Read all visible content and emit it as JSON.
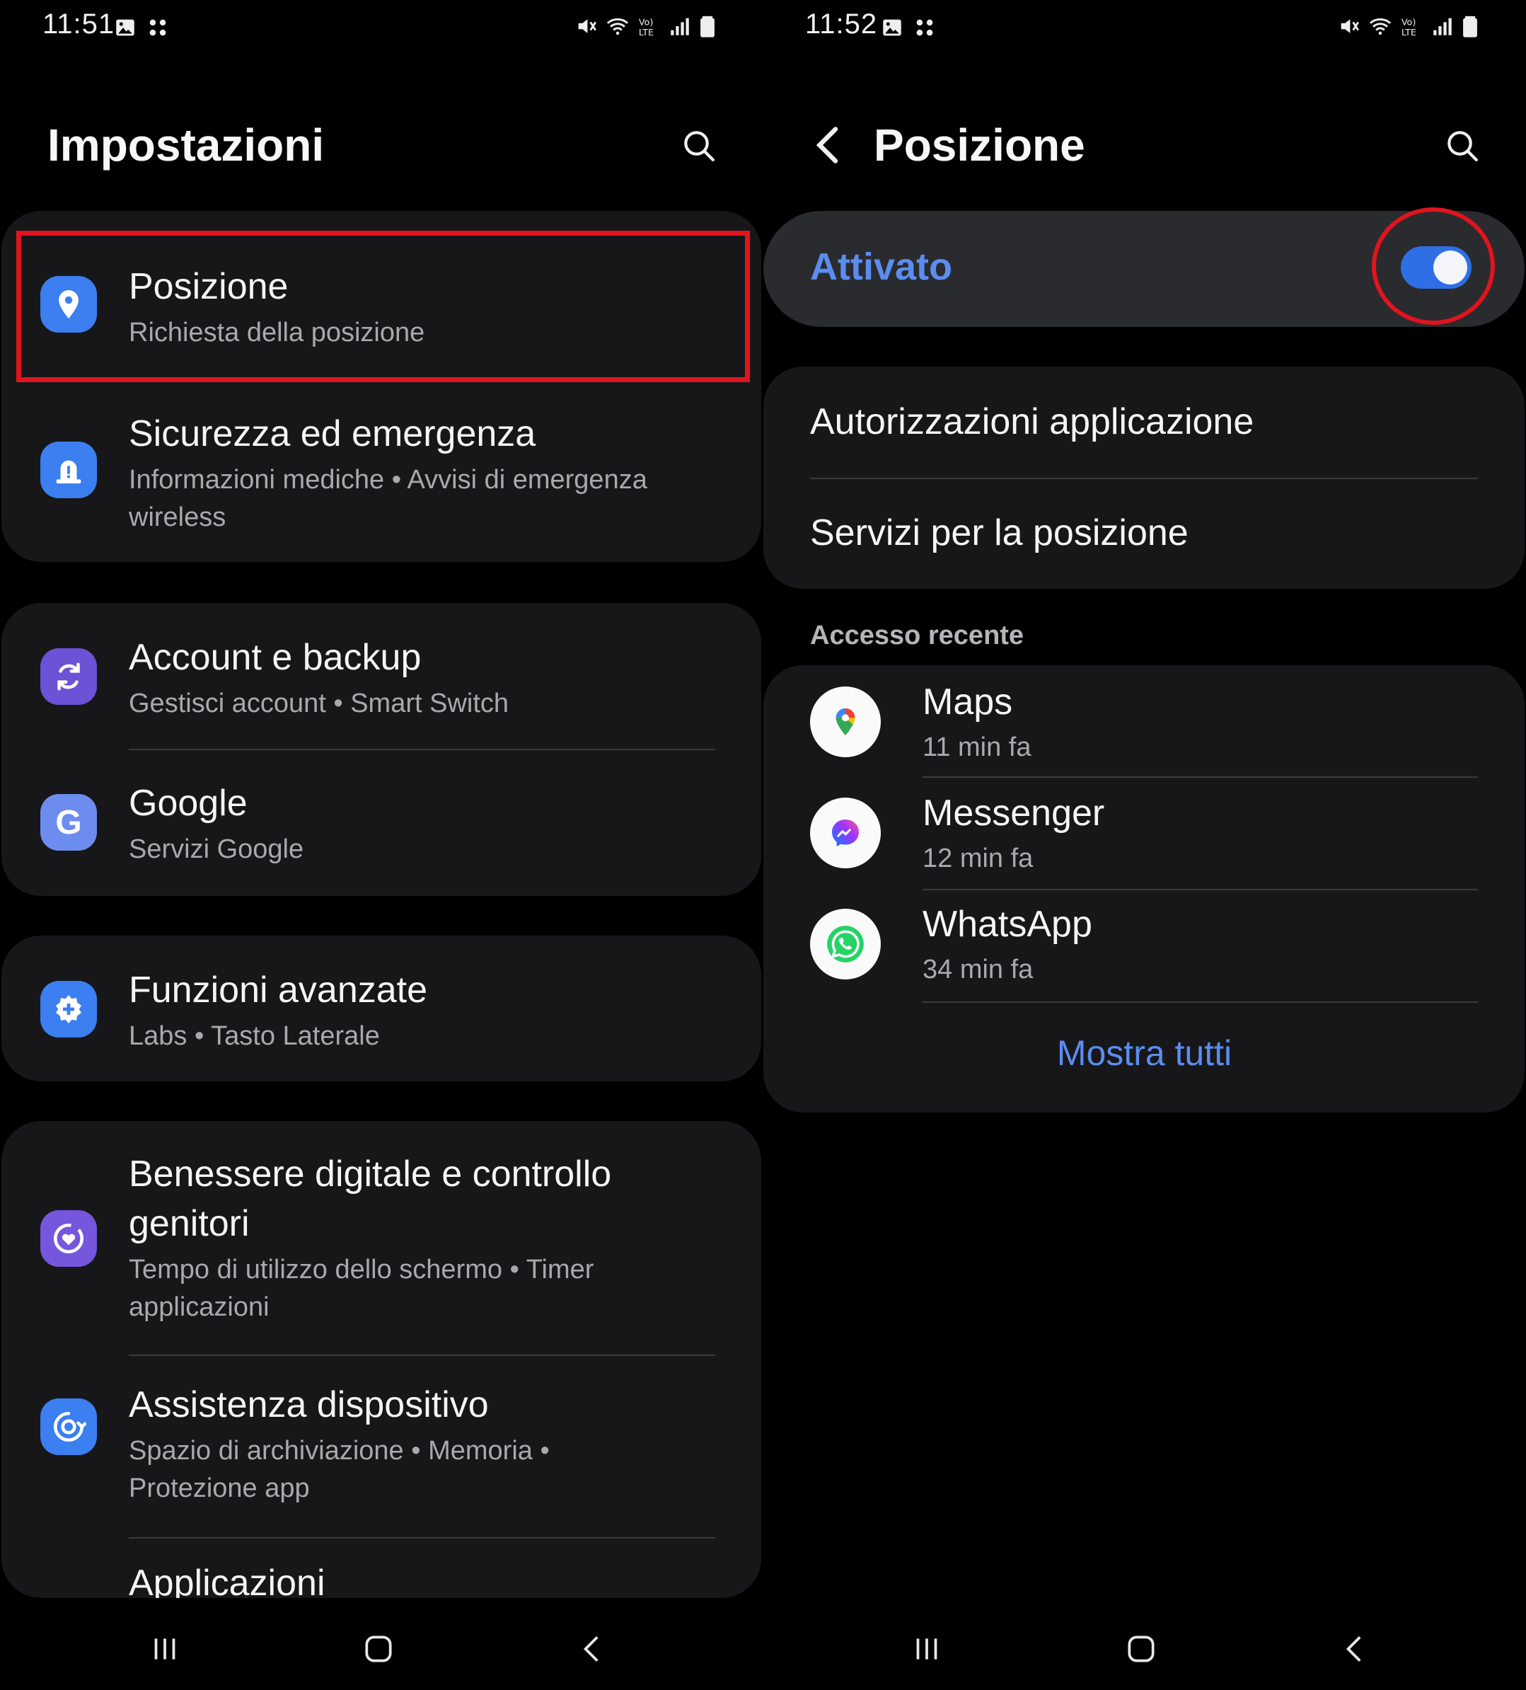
{
  "left": {
    "status": {
      "time": "11:51"
    },
    "title": "Impostazioni",
    "items": [
      {
        "title": "Posizione",
        "subtitle": "Richiesta della posizione"
      },
      {
        "title": "Sicurezza ed emergenza",
        "subtitle": "Informazioni mediche  •  Avvisi di emergenza wireless"
      },
      {
        "title": "Account e backup",
        "subtitle": "Gestisci account  •  Smart Switch"
      },
      {
        "title": "Google",
        "subtitle": "Servizi Google"
      },
      {
        "title": "Funzioni avanzate",
        "subtitle": "Labs  •  Tasto Laterale"
      },
      {
        "title": "Benessere digitale e controllo genitori",
        "subtitle": "Tempo di utilizzo dello schermo  •  Timer applicazioni"
      },
      {
        "title": "Assistenza dispositivo",
        "subtitle": "Spazio di archiviazione  •  Memoria  •  Protezione app"
      },
      {
        "title": "Applicazioni"
      }
    ]
  },
  "right": {
    "status": {
      "time": "11:52"
    },
    "title": "Posizione",
    "toggle": {
      "label": "Attivato",
      "on": true
    },
    "menu": [
      {
        "title": "Autorizzazioni applicazione"
      },
      {
        "title": "Servizi per la posizione"
      }
    ],
    "recent_label": "Accesso recente",
    "apps": [
      {
        "name": "Maps",
        "time": "11 min fa",
        "icon": "maps-icon"
      },
      {
        "name": "Messenger",
        "time": "12 min fa",
        "icon": "messenger-icon"
      },
      {
        "name": "WhatsApp",
        "time": "34 min fa",
        "icon": "whatsapp-icon"
      }
    ],
    "show_all": "Mostra tutti"
  },
  "colors": {
    "accent": "#5b8def",
    "toggle_on": "#2f6fe6",
    "highlight": "#e0141e",
    "card": "#171719"
  }
}
